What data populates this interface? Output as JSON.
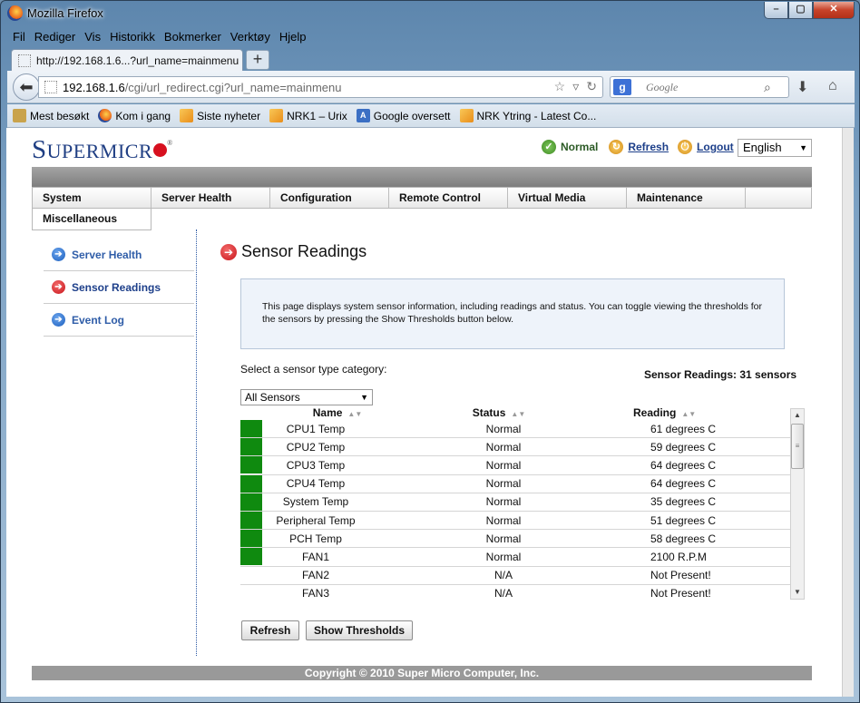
{
  "window": {
    "title": "Mozilla Firefox"
  },
  "menubar": [
    "Fil",
    "Rediger",
    "Vis",
    "Historikk",
    "Bokmerker",
    "Verktøy",
    "Hjelp"
  ],
  "tab": {
    "label": "http://192.168.1.6...?url_name=mainmenu"
  },
  "url": {
    "host": "192.168.1.6",
    "path": "/cgi/url_redirect.cgi?url_name=mainmenu"
  },
  "search": {
    "placeholder": "Google",
    "engine_icon": "google-icon"
  },
  "bookmarks": [
    "Mest besøkt",
    "Kom i gang",
    "Siste nyheter",
    "NRK1 – Urix",
    "Google oversett",
    "NRK Ytring - Latest Co..."
  ],
  "header": {
    "logo_first": "S",
    "logo_rest": "UPERMICR",
    "logo_reg": "®",
    "status": "Normal",
    "refresh": "Refresh",
    "logout": "Logout",
    "language": "English"
  },
  "nav": {
    "tabs": [
      "System",
      "Server Health",
      "Configuration",
      "Remote Control",
      "Virtual Media",
      "Maintenance"
    ],
    "sub": "Miscellaneous"
  },
  "sidebar": {
    "items": [
      {
        "label": "Server Health",
        "icon": "arrow-right-blue"
      },
      {
        "label": "Sensor Readings",
        "icon": "arrow-right-red"
      },
      {
        "label": "Event Log",
        "icon": "arrow-right-blue"
      }
    ]
  },
  "main": {
    "title": "Sensor Readings",
    "info": "This page displays system sensor information, including readings and status. You can toggle viewing the thresholds for the sensors by pressing the Show Thresholds button below.",
    "category_label": "Select a sensor type category:",
    "category_value": "All Sensors",
    "sensor_count": "Sensor Readings: 31 sensors",
    "columns": [
      "Name",
      "Status",
      "Reading"
    ],
    "rows": [
      {
        "name": "CPU1 Temp",
        "status": "Normal",
        "reading": "61 degrees C",
        "ok": true
      },
      {
        "name": "CPU2 Temp",
        "status": "Normal",
        "reading": "59 degrees C",
        "ok": true
      },
      {
        "name": "CPU3 Temp",
        "status": "Normal",
        "reading": "64 degrees C",
        "ok": true
      },
      {
        "name": "CPU4 Temp",
        "status": "Normal",
        "reading": "64 degrees C",
        "ok": true
      },
      {
        "name": "System Temp",
        "status": "Normal",
        "reading": "35 degrees C",
        "ok": true
      },
      {
        "name": "Peripheral Temp",
        "status": "Normal",
        "reading": "51 degrees C",
        "ok": true
      },
      {
        "name": "PCH Temp",
        "status": "Normal",
        "reading": "58 degrees C",
        "ok": true
      },
      {
        "name": "FAN1",
        "status": "Normal",
        "reading": "2100 R.P.M",
        "ok": true
      },
      {
        "name": "FAN2",
        "status": "N/A",
        "reading": "Not Present!",
        "ok": false
      },
      {
        "name": "FAN3",
        "status": "N/A",
        "reading": "Not Present!",
        "ok": false
      }
    ],
    "refresh_label": "Refresh",
    "thresholds_label": "Show Thresholds"
  },
  "footer": "Copyright © 2010 Super Micro Computer, Inc.",
  "colors": {
    "brand_blue": "#1f3e83",
    "ok_green": "#0f8a0f",
    "logo_red": "#d7101f"
  }
}
